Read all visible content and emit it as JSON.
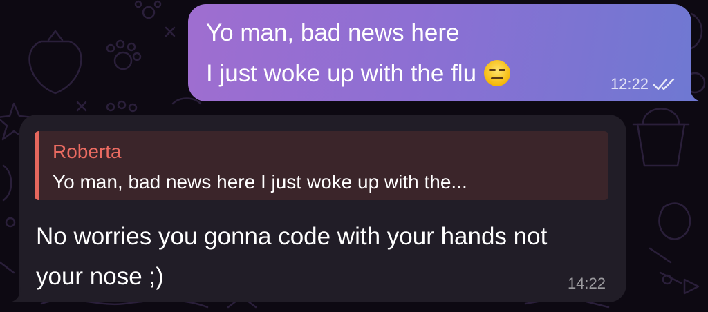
{
  "theme": {
    "wallpaper_color": "#0d0912",
    "outgoing_gradient": [
      "#9f6ed0",
      "#6f78d2"
    ],
    "incoming_bubble_color": "#211d27",
    "reply_accent_color": "#e5675d"
  },
  "messages": {
    "outgoing": {
      "line1": "Yo man, bad news here",
      "line2": "I just woke up with the flu",
      "emoji": "expressionless-face",
      "time": "12:22",
      "status_icon": "double-check-icon"
    },
    "incoming": {
      "reply": {
        "author": "Roberta",
        "preview": "Yo man, bad news here I just woke up with the..."
      },
      "text": "No worries you gonna code with your hands not your nose ;)",
      "time": "14:22"
    }
  }
}
